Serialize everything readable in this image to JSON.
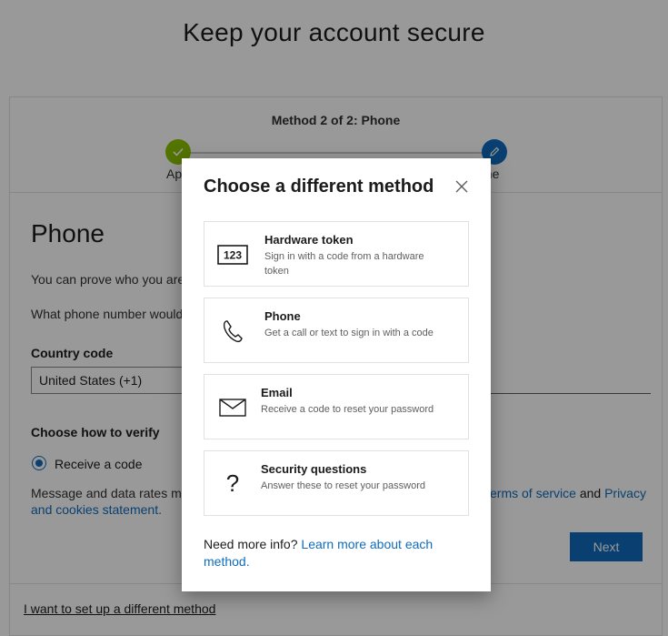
{
  "page": {
    "title": "Keep your account secure"
  },
  "steps": {
    "header": "Method 2 of 2: Phone",
    "step1_label": "Ap",
    "step2_label": "one"
  },
  "phone_section": {
    "title": "Phone",
    "desc1": "You can prove who you are",
    "desc2": "What phone number would",
    "country_label": "Country code",
    "country_value": "United States (+1)",
    "verify_label": "Choose how to verify",
    "radio_label": "Receive a code",
    "rates_text": "Message and data rates ma",
    "terms_link": "Terms of service",
    "and_text": "and",
    "privacy_link": "Privacy",
    "privacy_link2": "and cookies statement.",
    "next_button": "Next",
    "different_method_link": "I want to set up a different method"
  },
  "dialog": {
    "title": "Choose a different method",
    "options": [
      {
        "title": "Hardware token",
        "subtitle": "Sign in with a code from a hardware token",
        "icon": "hardware-token-icon",
        "icon_text": "123"
      },
      {
        "title": "Phone",
        "subtitle": "Get a call or text to sign in with a code",
        "icon": "phone-icon"
      },
      {
        "title": "Email",
        "subtitle": "Receive a code to reset your password",
        "icon": "envelope-icon"
      },
      {
        "title": "Security questions",
        "subtitle": "Answer these to reset your password",
        "icon": "question-icon",
        "icon_text": "?"
      }
    ],
    "more_info_prefix": "Need more info?",
    "more_info_link": "Learn more about each method."
  },
  "colors": {
    "accent": "#0f6cbd",
    "success": "#8dc100"
  }
}
